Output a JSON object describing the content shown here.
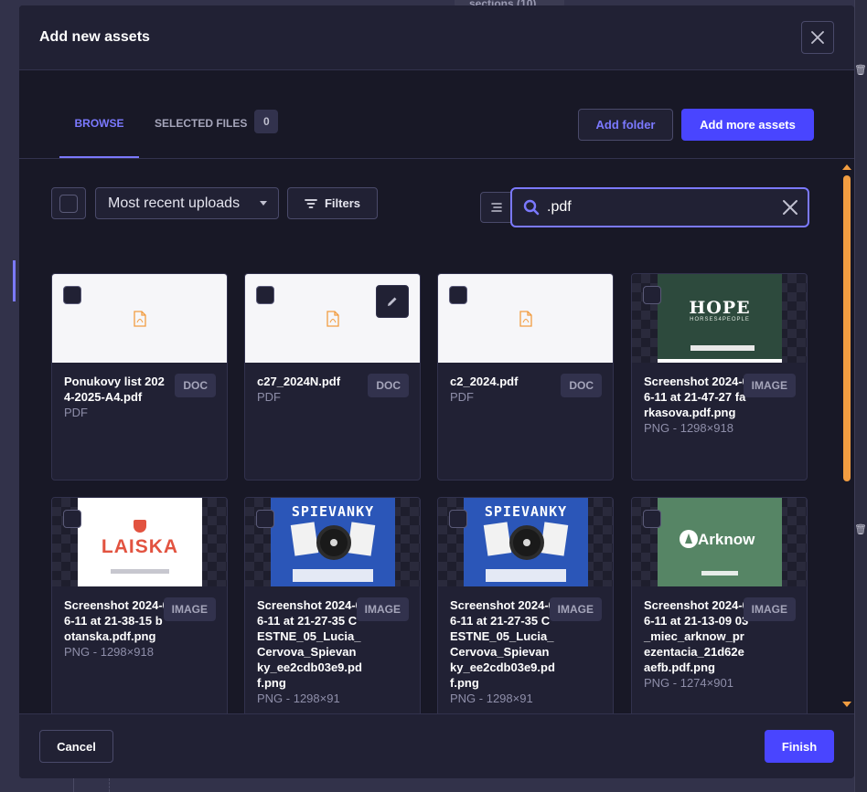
{
  "background": {
    "top_pill": "sections (10)"
  },
  "modal": {
    "title": "Add new assets",
    "close_icon": "close-icon"
  },
  "tabs": {
    "browse_label": "Browse",
    "selected_label": "Selected files",
    "selected_count": "0",
    "active": "browse"
  },
  "actions": {
    "add_folder_label": "Add folder",
    "add_more_label": "Add more assets"
  },
  "toolbar": {
    "sort_label": "Most recent uploads",
    "filters_label": "Filters",
    "search_value": ".pdf"
  },
  "assets": [
    {
      "name": "Ponukovy list 2024-2025-A4.pdf",
      "ext": "PDF",
      "badge": "DOC",
      "thumb": "pdf"
    },
    {
      "name": "c27_2024N.pdf",
      "ext": "PDF",
      "badge": "DOC",
      "thumb": "pdf"
    },
    {
      "name": "c2_2024.pdf",
      "ext": "PDF",
      "badge": "DOC",
      "thumb": "pdf"
    },
    {
      "name": "Screenshot 2024-06-11 at 21-47-27 farkasova.pdf.png",
      "ext": "PNG - 1298×918",
      "badge": "IMAGE",
      "thumb": "hope",
      "thumb_text": "HOPE",
      "thumb_subtext": "HORSES4PEOPLE"
    },
    {
      "name": "Screenshot 2024-06-11 at 21-38-15 botanska.pdf.png",
      "ext": "PNG - 1298×918",
      "badge": "IMAGE",
      "thumb": "laiska",
      "thumb_text": "LAISKA"
    },
    {
      "name": "Screenshot 2024-06-11 at 21-27-35 CESTNE_05_Lucia_Cervova_Spievanky_ee2cdb03e9.pdf.png",
      "ext": "PNG - 1298×91",
      "badge": "IMAGE",
      "thumb": "spiev",
      "thumb_text": "SPIEVANKY"
    },
    {
      "name": "Screenshot 2024-06-11 at 21-27-35 CESTNE_05_Lucia_Cervova_Spievanky_ee2cdb03e9.pdf.png",
      "ext": "PNG - 1298×91",
      "badge": "IMAGE",
      "thumb": "spiev",
      "thumb_text": "SPIEVANKY"
    },
    {
      "name": "Screenshot 2024-06-11 at 21-13-09 03_miec_arknow_prezentacia_21d62eaefb.pdf.png",
      "ext": "PNG - 1274×901",
      "badge": "IMAGE",
      "thumb": "arknow",
      "thumb_text": "Arknow"
    }
  ],
  "footer": {
    "cancel_label": "Cancel",
    "finish_label": "Finish"
  },
  "colors": {
    "accent": "#7b79ff",
    "primary": "#4945ff",
    "scrollbar": "#f29d41",
    "modal_bg": "#181826",
    "header_bg": "#212134"
  }
}
